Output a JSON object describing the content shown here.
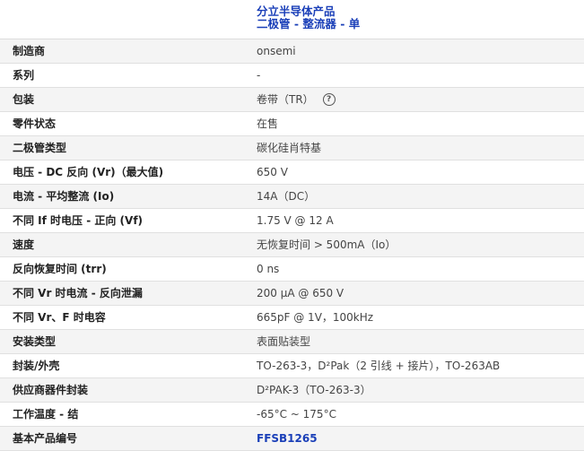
{
  "category": {
    "line1": "分立半导体产品",
    "line2": "二极管 - 整流器 - 单"
  },
  "specs": [
    {
      "label": "制造商",
      "value": "onsemi"
    },
    {
      "label": "系列",
      "value": "-"
    },
    {
      "label": "包装",
      "value": "卷带（TR）"
    },
    {
      "label": "零件状态",
      "value": "在售"
    },
    {
      "label": "二极管类型",
      "value": "碳化硅肖特基"
    },
    {
      "label": "电压 - DC 反向 (Vr)（最大值)",
      "value": "650 V"
    },
    {
      "label": "电流 - 平均整流 (Io)",
      "value": "14A（DC）"
    },
    {
      "label": "不同 If 时电压 - 正向 (Vf)",
      "value": "1.75 V @ 12 A"
    },
    {
      "label": "速度",
      "value": "无恢复时间 > 500mA（Io）"
    },
    {
      "label": "反向恢复时间 (trr)",
      "value": "0 ns"
    },
    {
      "label": "不同 Vr 时电流 - 反向泄漏",
      "value": "200 µA @ 650 V"
    },
    {
      "label": "不同 Vr、F 时电容",
      "value": "665pF @ 1V，100kHz"
    },
    {
      "label": "安装类型",
      "value": "表面贴装型"
    },
    {
      "label": "封装/外壳",
      "value": "TO-263-3，D²Pak（2 引线 + 接片），TO-263AB"
    },
    {
      "label": "供应商器件封装",
      "value": "D²PAK-3（TO-263-3）"
    },
    {
      "label": "工作温度 - 结",
      "value": "-65°C ~ 175°C"
    },
    {
      "label": "基本产品编号",
      "value": "FFSB1265"
    }
  ],
  "icons": {
    "packaging_help": "question-circle-icon",
    "help_glyph": "?"
  },
  "colors": {
    "link": "#1a3fb8",
    "row_alt": "#f4f4f4"
  }
}
